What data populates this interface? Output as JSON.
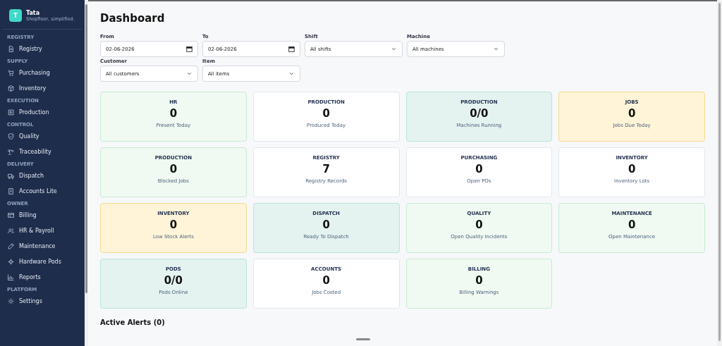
{
  "brand": {
    "initial": "T",
    "name": "Tata",
    "tagline": "Shopfloor, simplified."
  },
  "sidebar": {
    "sections": [
      {
        "label": "REGISTRY",
        "items": [
          {
            "label": "Registry",
            "selected": false
          }
        ]
      },
      {
        "label": "SUPPLY",
        "items": [
          {
            "label": "Purchasing",
            "selected": false
          },
          {
            "label": "Inventory",
            "selected": false
          }
        ]
      },
      {
        "label": "EXECUTION",
        "items": [
          {
            "label": "Production",
            "selected": false
          }
        ]
      },
      {
        "label": "CONTROL",
        "items": [
          {
            "label": "Quality",
            "selected": false
          },
          {
            "label": "Traceability",
            "selected": false
          }
        ]
      },
      {
        "label": "DELIVERY",
        "items": [
          {
            "label": "Dispatch",
            "selected": false
          },
          {
            "label": "Accounts Lite",
            "selected": false
          }
        ]
      },
      {
        "label": "OWNER",
        "items": [
          {
            "label": "Billing",
            "selected": false
          },
          {
            "label": "HR & Payroll",
            "selected": false
          },
          {
            "label": "Maintenance",
            "selected": false
          },
          {
            "label": "Hardware Pods",
            "selected": false
          },
          {
            "label": "Reports",
            "selected": false
          }
        ]
      },
      {
        "label": "PLATFORM",
        "items": [
          {
            "label": "Settings",
            "selected": false
          }
        ]
      }
    ]
  },
  "page": {
    "title": "Dashboard"
  },
  "filters": [
    {
      "label": "From",
      "kind": "date",
      "value": "02-06-2026"
    },
    {
      "label": "To",
      "kind": "date",
      "value": "02-06-2026"
    },
    {
      "label": "Shift",
      "kind": "select",
      "value": "All shifts"
    },
    {
      "label": "Machine",
      "kind": "select",
      "value": "All machines"
    },
    {
      "label": "Customer",
      "kind": "select",
      "value": "All customers"
    },
    {
      "label": "Item",
      "kind": "select",
      "value": "All items"
    }
  ],
  "cards": [
    {
      "module": "HR",
      "value": "0",
      "caption": "Present Today",
      "color": "#f0faf2"
    },
    {
      "module": "PRODUCTION",
      "value": "0",
      "caption": "Produced Today",
      "color": "#ffffff"
    },
    {
      "module": "PRODUCTION",
      "value": "0/0",
      "caption": "Machines Running",
      "color": "#e4f3f0"
    },
    {
      "module": "JOBS",
      "value": "0",
      "caption": "Jobs Due Today",
      "color": "#fff4d8"
    },
    {
      "module": "PRODUCTION",
      "value": "0",
      "caption": "Blocked Jobs",
      "color": "#f0faf2"
    },
    {
      "module": "REGISTRY",
      "value": "7",
      "caption": "Registry Records",
      "color": "#ffffff"
    },
    {
      "module": "PURCHASING",
      "value": "0",
      "caption": "Open POs",
      "color": "#ffffff"
    },
    {
      "module": "INVENTORY",
      "value": "0",
      "caption": "Inventory Lots",
      "color": "#ffffff"
    },
    {
      "module": "INVENTORY",
      "value": "0",
      "caption": "Low Stock Alerts",
      "color": "#fff4d8"
    },
    {
      "module": "DISPATCH",
      "value": "0",
      "caption": "Ready To Dispatch",
      "color": "#e4f3f0"
    },
    {
      "module": "QUALITY",
      "value": "0",
      "caption": "Open Quality Incidents",
      "color": "#f0faf2"
    },
    {
      "module": "MAINTENANCE",
      "value": "0",
      "caption": "Open Maintenance",
      "color": "#f0faf2"
    },
    {
      "module": "PODS",
      "value": "0/0",
      "caption": "Pods Online",
      "color": "#e4f3f0"
    },
    {
      "module": "ACCOUNTS",
      "value": "0",
      "caption": "Jobs Costed",
      "color": "#ffffff"
    },
    {
      "module": "BILLING",
      "value": "0",
      "caption": "Billing Warnings",
      "color": "#f0faf2"
    }
  ],
  "alerts": {
    "title": "Active Alerts (0)"
  }
}
